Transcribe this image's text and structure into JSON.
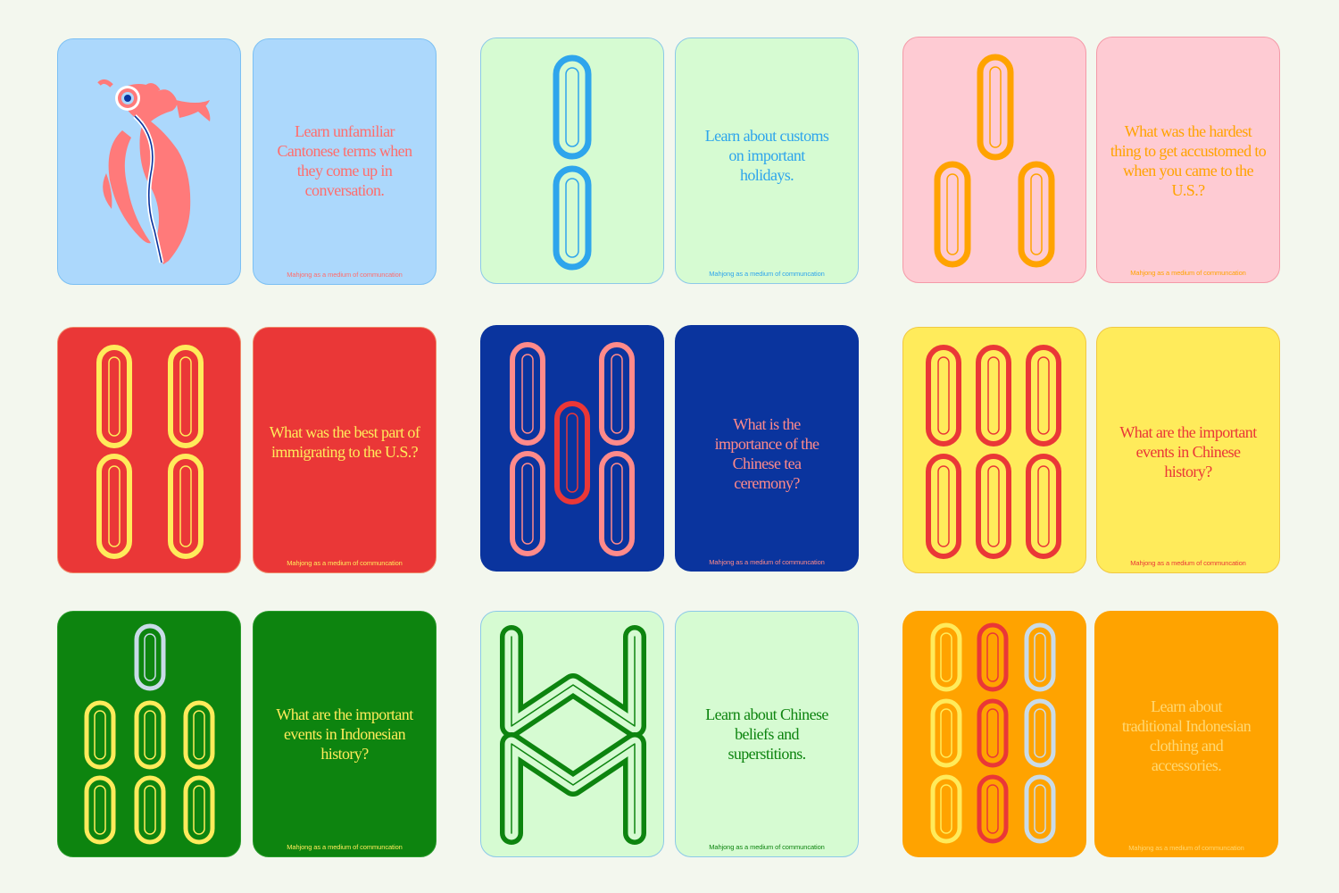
{
  "footer_text": "Mahjong as a medium of communcation",
  "colors": {
    "background": "#f3f7ee",
    "light_blue": "#acd8fc",
    "mint": "#d6fbd2",
    "pink": "#fecbd3",
    "red": "#ea3737",
    "navy": "#0a349e",
    "yellow": "#ffeb5b",
    "green": "#0d840f",
    "orange": "#ffa300"
  },
  "cards": [
    {
      "id": "bird",
      "text": "Learn unfamiliar Cantonese terms when they come up in conversation."
    },
    {
      "id": "two-bamboo",
      "text": "Learn about customs on important holidays."
    },
    {
      "id": "three-bamboo",
      "text": "What was the hardest thing to get accustomed to when you came to the U.S.?"
    },
    {
      "id": "four-bamboo",
      "text": "What was the best part of immigrating to the U.S.?"
    },
    {
      "id": "five-bamboo",
      "text": "What is the importance of the Chinese tea ceremony?"
    },
    {
      "id": "six-bamboo",
      "text": "What are the important events in Chinese history?"
    },
    {
      "id": "seven-bamboo",
      "text": "What are the important events in Indonesian history?"
    },
    {
      "id": "eight-bamboo",
      "text": "Learn about Chinese beliefs and superstitions."
    },
    {
      "id": "nine-bamboo",
      "text": "Learn about traditional Indonesian clothing and accessories."
    }
  ]
}
